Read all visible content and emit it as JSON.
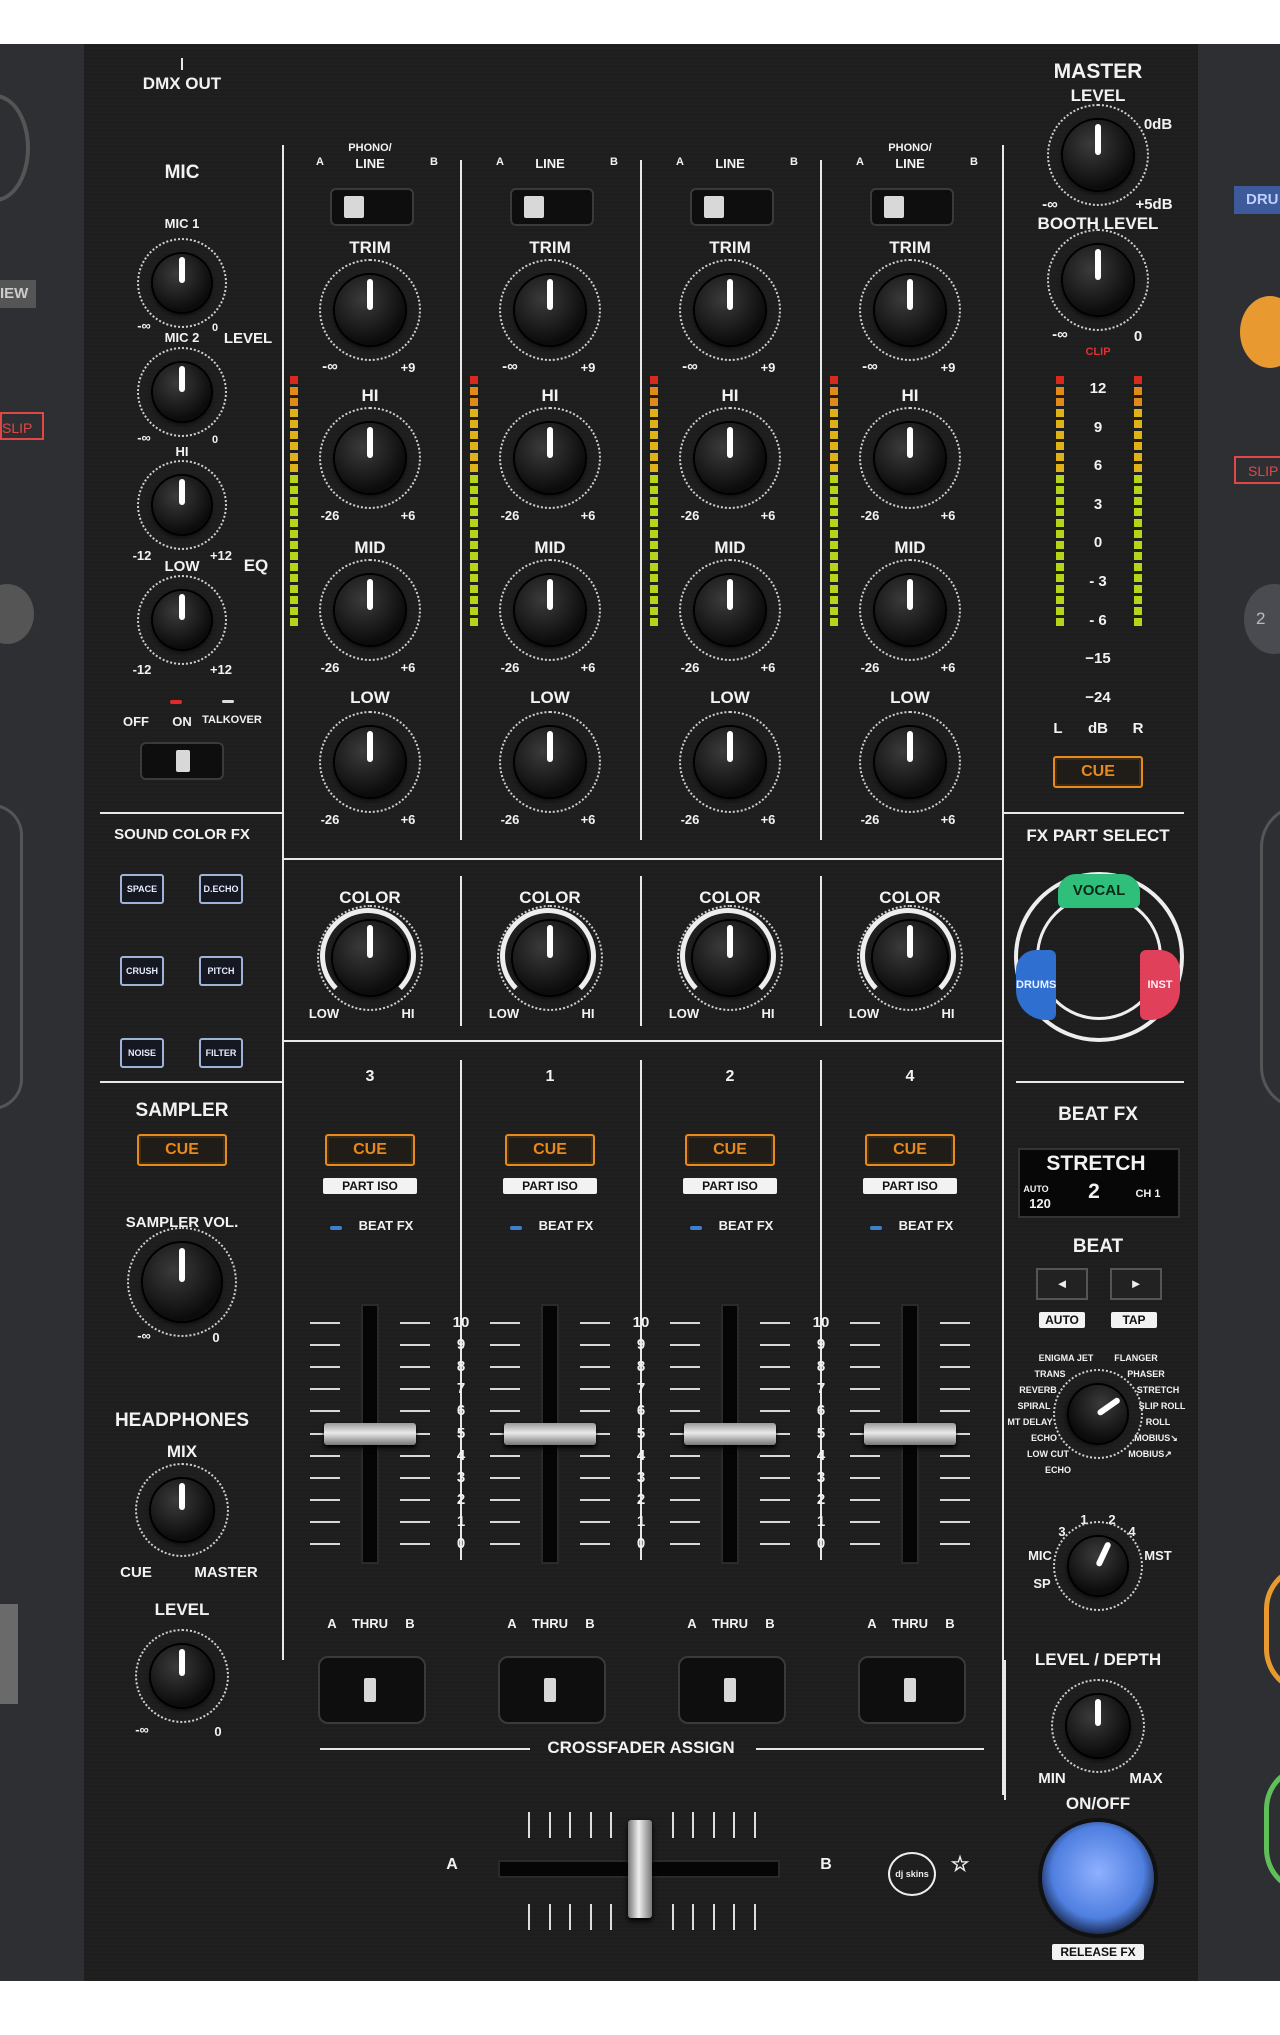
{
  "dmx_out": "DMX OUT",
  "mic": {
    "title": "MIC",
    "mic1": "MIC 1",
    "mic2": "MIC 2",
    "level": "LEVEL",
    "minus_inf": "-∞",
    "zero": "0",
    "hi": "HI",
    "low": "LOW",
    "minus12": "-12",
    "plus12": "+12",
    "eq": "EQ",
    "off": "OFF",
    "on": "ON",
    "talkover": "TALKOVER"
  },
  "channels": [
    {
      "input_top": "PHONO/",
      "input_bottom": "LINE",
      "a": "A",
      "b": "B",
      "number": "3"
    },
    {
      "input_top": "",
      "input_bottom": "LINE",
      "a": "A",
      "b": "B",
      "number": "1"
    },
    {
      "input_top": "",
      "input_bottom": "LINE",
      "a": "A",
      "b": "B",
      "number": "2"
    },
    {
      "input_top": "PHONO/",
      "input_bottom": "LINE",
      "a": "A",
      "b": "B",
      "number": "4"
    }
  ],
  "channel_labels": {
    "trim": "TRIM",
    "hi": "HI",
    "mid": "MID",
    "low": "LOW",
    "trim_min": "-∞",
    "trim_max": "+9",
    "eq_min": "-26",
    "eq_max": "+6",
    "color": "COLOR",
    "color_low": "LOW",
    "color_hi": "HI",
    "cue": "CUE",
    "part_iso": "PART ISO",
    "beat_fx": "BEAT FX",
    "thru_a": "A",
    "thru": "THRU",
    "thru_b": "B"
  },
  "fader_scale": [
    "10",
    "9",
    "8",
    "7",
    "6",
    "5",
    "4",
    "3",
    "2",
    "1",
    "0"
  ],
  "crossfader_assign": "CROSSFADER ASSIGN",
  "crossfader": {
    "a": "A",
    "b": "B"
  },
  "master": {
    "title": "MASTER",
    "level": "LEVEL",
    "zero_db": "0dB",
    "minus_inf": "-∞",
    "plus5db": "+5dB",
    "booth_level": "BOOTH LEVEL",
    "booth_min": "-∞",
    "booth_max": "0",
    "clip": "CLIP",
    "meter_scale": [
      "12",
      "9",
      "6",
      "3",
      "0",
      "- 3",
      "- 6",
      "−15",
      "−24"
    ],
    "l": "L",
    "db": "dB",
    "r": "R",
    "cue": "CUE"
  },
  "sound_color_fx": {
    "title": "SOUND COLOR FX",
    "buttons": [
      "SPACE",
      "D.ECHO",
      "CRUSH",
      "PITCH",
      "NOISE",
      "FILTER"
    ]
  },
  "fx_part_select": {
    "title": "FX PART SELECT",
    "vocal": "VOCAL",
    "drums": "DRUMS",
    "inst": "INST"
  },
  "sampler": {
    "title": "SAMPLER",
    "cue": "CUE",
    "vol": "SAMPLER VOL.",
    "min": "-∞",
    "max": "0"
  },
  "headphones": {
    "title": "HEADPHONES",
    "mix": "MIX",
    "cue": "CUE",
    "master": "MASTER",
    "level": "LEVEL",
    "min": "-∞",
    "max": "0"
  },
  "beat_fx": {
    "title": "BEAT FX",
    "display_effect": "STRETCH",
    "display_mode": "AUTO",
    "display_bpm": "120",
    "display_beat": "2",
    "display_ch": "CH 1",
    "beat": "BEAT",
    "auto": "AUTO",
    "tap": "TAP",
    "effects_left": [
      "ENIGMA JET",
      "TRANS",
      "REVERB",
      "SPIRAL",
      "MT DELAY",
      "ECHO",
      "LOW CUT",
      "ECHO"
    ],
    "effects_right": [
      "FLANGER",
      "PHASER",
      "STRETCH",
      "SLIP ROLL",
      "ROLL",
      "MOBIUS↘",
      "MOBIUS↗"
    ],
    "ch_select": [
      "1",
      "2",
      "3",
      "4",
      "MIC",
      "MST",
      "SP"
    ],
    "level_depth": "LEVEL / DEPTH",
    "min": "MIN",
    "max": "MAX",
    "on_off": "ON/OFF",
    "release_fx": "RELEASE FX"
  },
  "logo": "dj skins",
  "side_labels": {
    "view": "IEW",
    "slip_left": "SLIP",
    "drum": "DRU",
    "slip_right": "SLIP",
    "right_2": "2"
  },
  "colors": {
    "cue": "#e8891c",
    "vocal": "#2fbf7a",
    "drums": "#2f6fd0",
    "inst": "#e0405a",
    "on_off": "#4f7fe0"
  }
}
